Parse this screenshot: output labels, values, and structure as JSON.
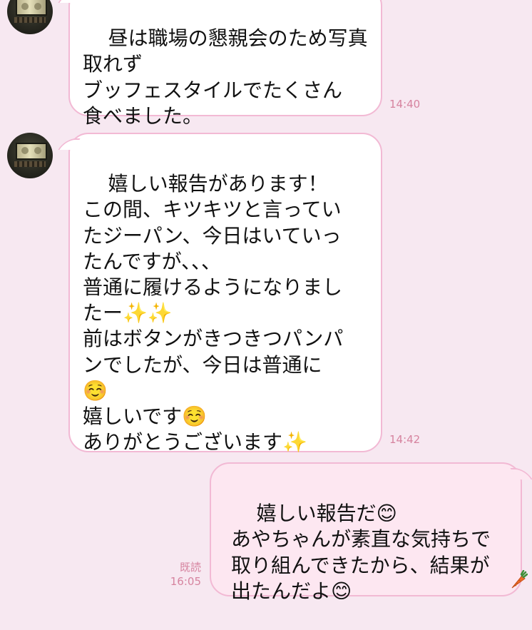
{
  "messages": [
    {
      "text": "昼は職場の懇親会のため写真\n取れず\nブッフェスタイルでたくさん\n食べました。",
      "time": "14:40"
    },
    {
      "text": "嬉しい報告があります！\nこの間、キツキツと言ってい\nたジーパン、今日はいていっ\nたんですが、、、\n普通に履けるようになりまし\nたー✨✨\n前はボタンがきつきつパンパ\nンでしたが、今日は普通に\n☺️\n嬉しいです☺️\nありがとうございます✨",
      "time": "14:42"
    },
    {
      "text": "嬉しい報告だ😊\nあやちゃんが素直な気持ちで\n取り組んできたから、結果が\n出たんだよ😊",
      "read_label": "既読",
      "time": "16:05"
    }
  ],
  "icons": {
    "avatar": "avatar-photo",
    "sticker": "carrot-icon"
  },
  "colors": {
    "background": "#f7e8f1",
    "bubble_border": "#f2b9d4",
    "incoming_bubble": "#ffffff",
    "outgoing_bubble": "#fde7f1",
    "timestamp": "#d6839f"
  }
}
